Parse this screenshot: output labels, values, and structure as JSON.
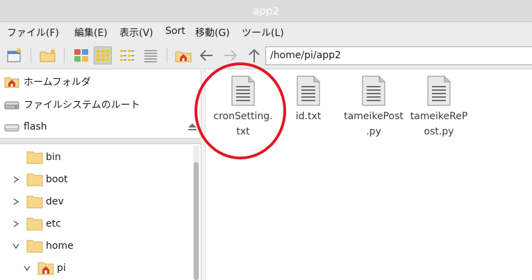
{
  "window": {
    "title": "app2"
  },
  "menu": [
    {
      "label": "ファイル(F)"
    },
    {
      "label": "編集(E)"
    },
    {
      "label": "表示(V)"
    },
    {
      "label": "Sort"
    },
    {
      "label": "移動(G)"
    },
    {
      "label": "ツール(L)"
    }
  ],
  "toolbar": {
    "path": "/home/pi/app2",
    "buttons": [
      "new-window-icon",
      "new-folder-icon",
      "thumbnail-view-icon",
      "icon-view-icon",
      "compact-view-icon",
      "list-view-icon",
      "home-icon",
      "back-arrow-icon",
      "forward-arrow-icon",
      "up-arrow-icon"
    ],
    "active_view": "icon-view"
  },
  "places": [
    {
      "label": "ホームフォルダ",
      "icon": "home-folder-icon"
    },
    {
      "label": "ファイルシステムのルート",
      "icon": "drive-icon"
    },
    {
      "label": "flash",
      "icon": "removable-drive-icon"
    }
  ],
  "tree": [
    {
      "label": "bin",
      "expander": "none",
      "icon": "folder-icon"
    },
    {
      "label": "boot",
      "expander": "collapsed",
      "icon": "folder-icon"
    },
    {
      "label": "dev",
      "expander": "collapsed",
      "icon": "folder-icon"
    },
    {
      "label": "etc",
      "expander": "collapsed",
      "icon": "folder-icon"
    },
    {
      "label": "home",
      "expander": "expanded",
      "icon": "folder-icon"
    },
    {
      "label": "pi",
      "expander": "expanded",
      "icon": "home-folder-icon"
    }
  ],
  "files": [
    {
      "line1": "cronSetting.",
      "line2": "txt"
    },
    {
      "line1": "id.txt",
      "line2": ""
    },
    {
      "line1": "tameikePost",
      "line2": ".py"
    },
    {
      "line1": "tameikeReP",
      "line2": "ost.py"
    }
  ],
  "colors": {
    "annotation": "#e01722",
    "folder": "#f7d78a",
    "home_badge": "#d2422a"
  }
}
